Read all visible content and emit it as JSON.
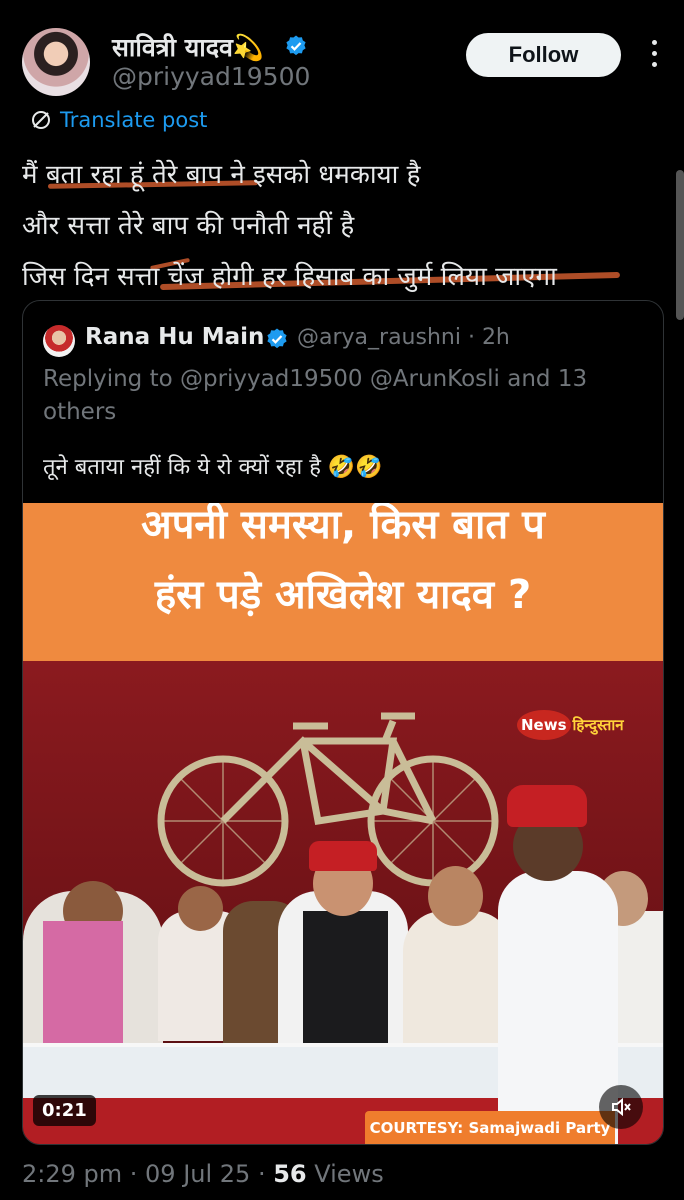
{
  "author": {
    "display_name": "सावित्री यादव💫",
    "handle": "@priyyad19500"
  },
  "follow_label": "Follow",
  "translate_label": "Translate post",
  "post_lines": [
    "मैं बता रहा हूं तेरे बाप ने इसको धमकाया है",
    "और सत्ता तेरे बाप की पनौती नहीं है",
    "जिस दिन सत्ता चेंज होगी हर हिसाब का जुर्म लिया जाएगा"
  ],
  "quote": {
    "display_name": "Rana Hu Main",
    "handle_time": "@arya_raushni · 2h",
    "replying_to": "Replying to @priyyad19500 @ArunKosli and 13 others",
    "text": "तूने बताया नहीं कि ये रो क्यों रहा है 🤣🤣",
    "media": {
      "headline_line1": "अपनी समस्या, किस बात प",
      "headline_line2": "हंस पड़े अखिलेश यादव ?",
      "logo_news": "News",
      "logo_hindi": "हिन्दुस्तान",
      "duration": "0:21",
      "courtesy": "COURTESY: Samajwadi Party"
    }
  },
  "meta": {
    "time_date": "2:29 pm · 09 Jul 25 · ",
    "views_count": "56",
    "views_label": " Views"
  },
  "colors": {
    "background": "#000000",
    "link_blue": "#1d9bf0",
    "muted_text": "#71767b",
    "verified": "#1d9bf0",
    "banner_orange": "#ef8a3f",
    "underline_scribble": "#c1552b"
  },
  "icons": [
    "verified-badge-icon",
    "more-icon",
    "translate-icon",
    "mute-icon",
    "bicycle-icon"
  ]
}
